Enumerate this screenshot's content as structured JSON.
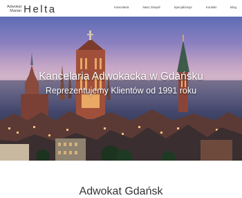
{
  "logo": {
    "line1": "Adwokat",
    "line2": "Marian",
    "name": "Helta"
  },
  "nav": {
    "items": [
      {
        "label": "Kancelaria"
      },
      {
        "label": "Nasz Zespół"
      },
      {
        "label": "Specjalizacje"
      },
      {
        "label": "Kontakt"
      },
      {
        "label": "Blog"
      }
    ]
  },
  "hero": {
    "title": "Kancelaria Adwokacka w Gdańsku",
    "subtitle": "Reprezentujemy Klientów od 1991 roku"
  },
  "section": {
    "title": "Adwokat Gdańsk"
  }
}
